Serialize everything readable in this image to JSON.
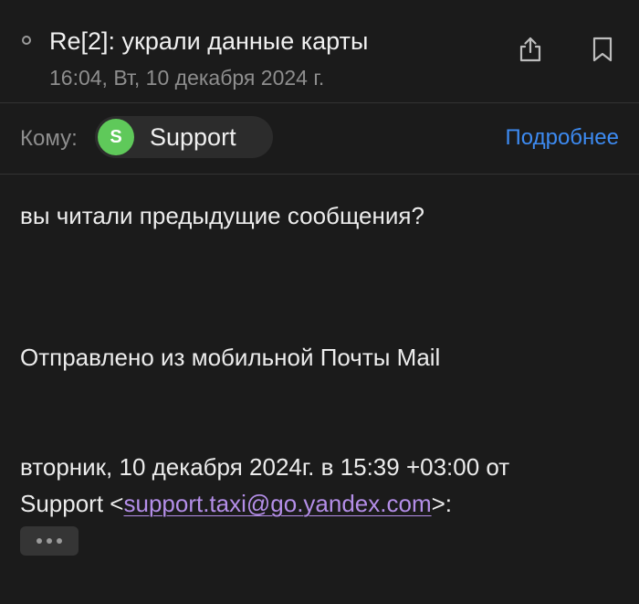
{
  "header": {
    "subject": "Re[2]: украли данные карты",
    "date": "16:04, Вт, 10 декабря 2024 г.",
    "icons": [
      "unread-indicator-icon",
      "share-icon",
      "bookmark-icon"
    ]
  },
  "recipients": {
    "label": "Кому:",
    "contact": {
      "initial": "S",
      "name": "Support"
    },
    "details_link": "Подробнее"
  },
  "message": {
    "body": "вы читали предыдущие сообщения?",
    "signature": "Отправлено из мобильной Почты Mail",
    "quote_header": {
      "line1": "вторник, 10 декабря 2024г. в 15:39 +03:00 от",
      "prefix": "Support <",
      "email": "support.taxi@go.yandex.com",
      "suffix": ">:"
    }
  },
  "colors": {
    "background": "#1b1b1b",
    "link": "#3d8bf2",
    "email_link": "#b48ee8",
    "avatar": "#5fc95a"
  }
}
